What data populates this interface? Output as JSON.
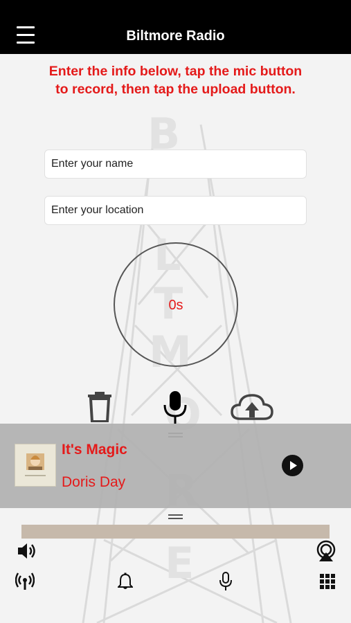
{
  "header": {
    "title": "Biltmore Radio"
  },
  "instructions": "Enter the info below, tap the mic button to record, then tap the upload button.",
  "form": {
    "name_placeholder": "Enter your name",
    "location_placeholder": "Enter your location"
  },
  "recorder": {
    "elapsed": "0s"
  },
  "now_playing": {
    "title": "It's Magic",
    "artist": "Doris Day",
    "progress": 0
  },
  "colors": {
    "accent_red": "#e41a1a",
    "header_bg": "#000000"
  },
  "icons": [
    "menu-icon",
    "trash-icon",
    "microphone-icon",
    "cloud-upload-icon",
    "play-icon",
    "volume-icon",
    "airplay-icon",
    "podcast-icon",
    "bell-icon",
    "microphone-icon",
    "grid-icon"
  ]
}
